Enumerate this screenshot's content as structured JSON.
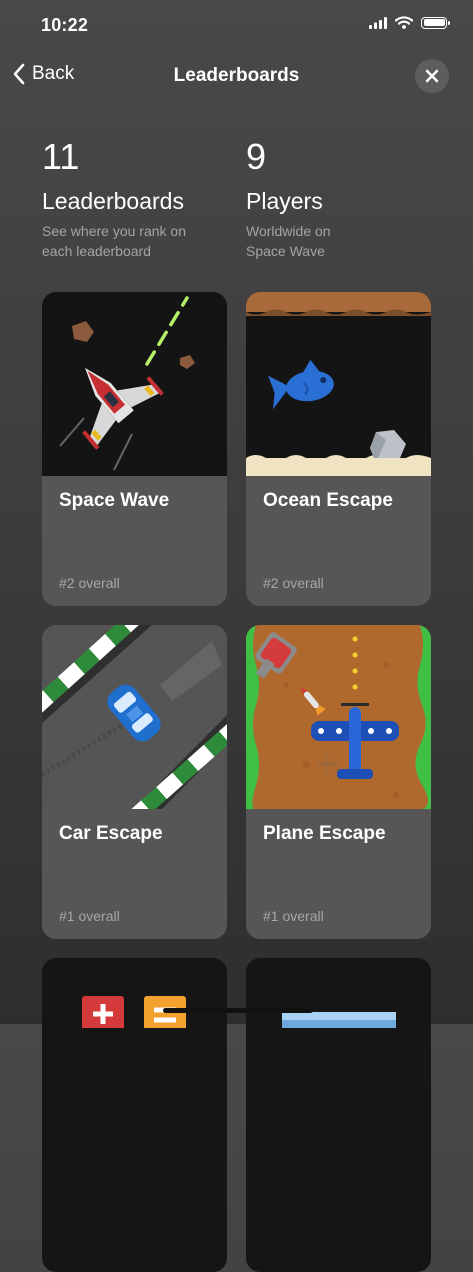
{
  "status_bar": {
    "time": "10:22"
  },
  "nav": {
    "back_label": "Back",
    "title": "Leaderboards"
  },
  "stats": [
    {
      "value": "11",
      "label": "Leaderboards",
      "sub": "See where you rank on\neach leaderboard"
    },
    {
      "value": "9",
      "label": "Players",
      "sub": "Worldwide on\nSpace Wave"
    }
  ],
  "cards": [
    {
      "title": "Space Wave",
      "rank": "#2 overall"
    },
    {
      "title": "Ocean Escape",
      "rank": "#2 overall"
    },
    {
      "title": "Car Escape",
      "rank": "#1 overall"
    },
    {
      "title": "Plane Escape",
      "rank": "#1 overall"
    }
  ]
}
